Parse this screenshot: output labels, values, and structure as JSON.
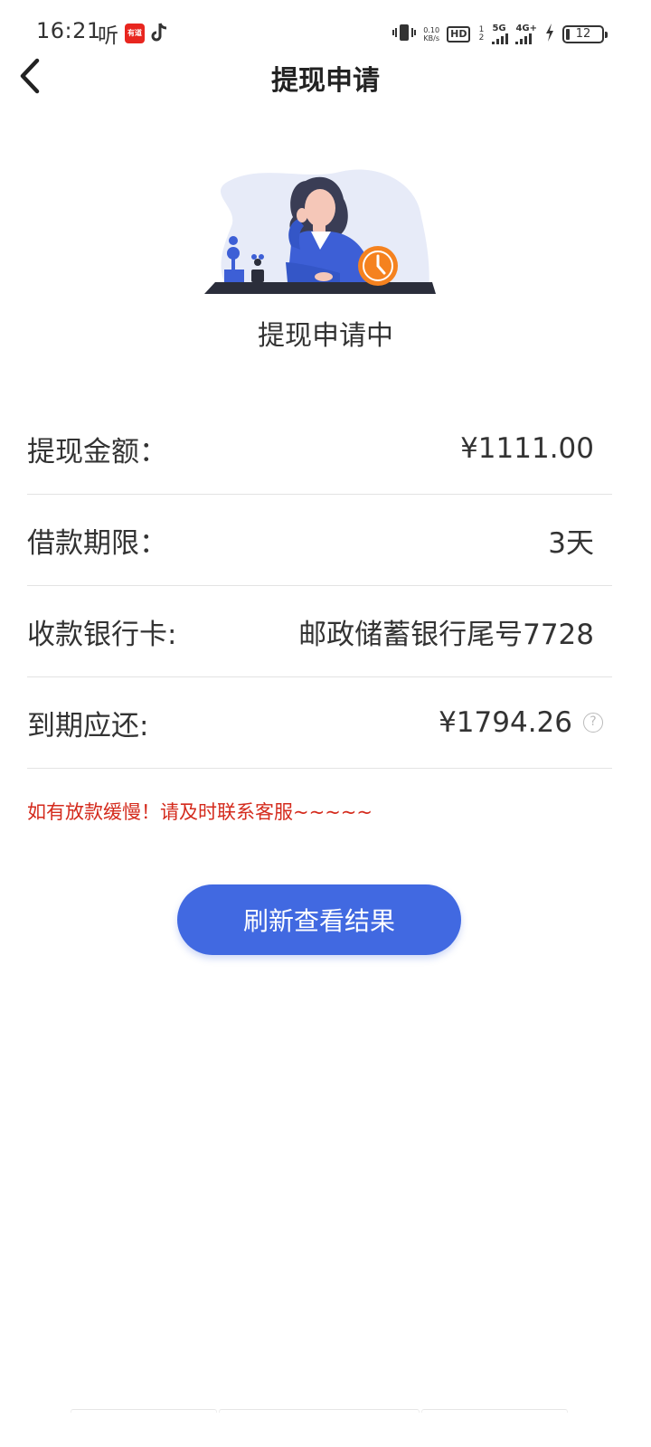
{
  "status_bar": {
    "time": "16:21",
    "ting": "听",
    "red_app_label": "有道",
    "net_speed_value": "0.10",
    "net_speed_unit": "KB/s",
    "hd_label": "HD",
    "sim_index": "1 2",
    "net_5g": "5G",
    "net_4g": "4G+",
    "battery_level": "12"
  },
  "nav": {
    "title": "提现申请",
    "back_icon": "chevron-left-icon"
  },
  "status": {
    "text": "提现申请中"
  },
  "info": {
    "rows": [
      {
        "label": "提现金额：",
        "value": "¥1111.00"
      },
      {
        "label": "借款期限：",
        "value": "3天"
      },
      {
        "label": "收款银行卡:",
        "value": "邮政储蓄银行尾号7728"
      },
      {
        "label": "到期应还:",
        "value": "¥1794.26"
      }
    ],
    "help_symbol": "?"
  },
  "notice": "如有放款缓慢！请及时联系客服~~~~~",
  "refresh_button": "刷新查看结果",
  "colors": {
    "primary": "#4169e1",
    "notice": "#d42a1c",
    "clock_orange": "#f5821f"
  }
}
